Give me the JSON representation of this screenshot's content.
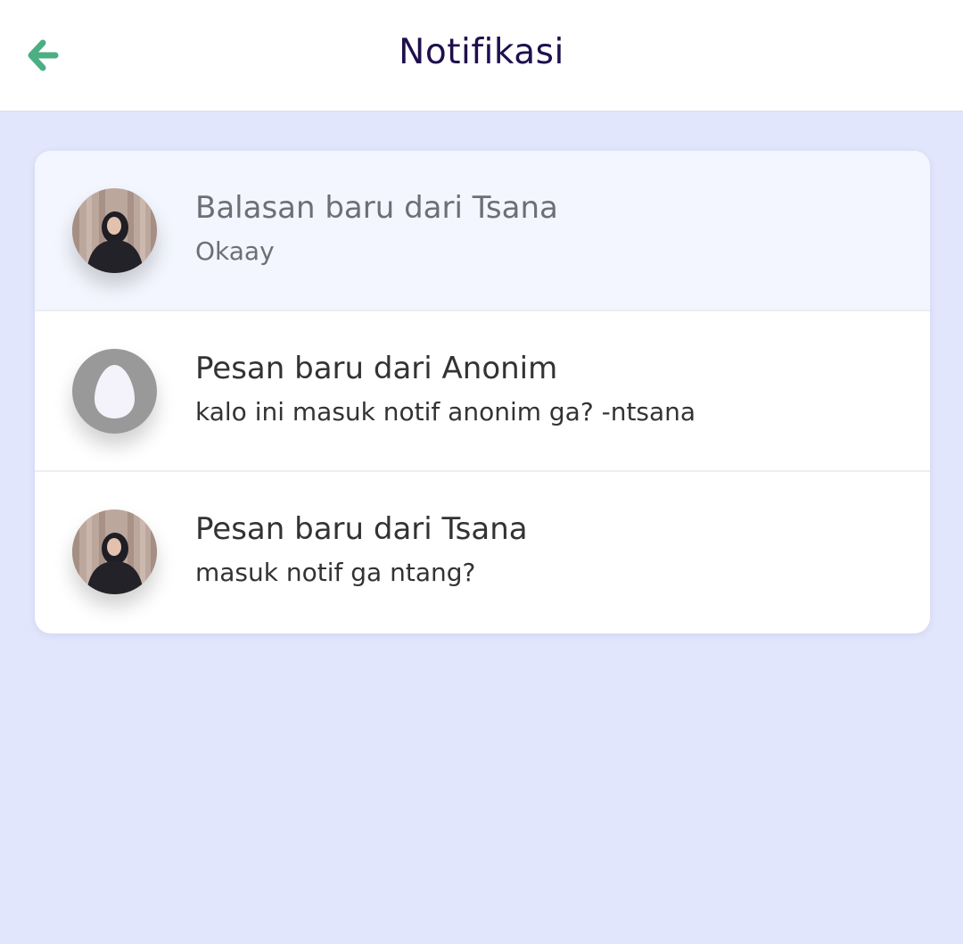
{
  "header": {
    "title": "Notifikasi",
    "back_icon": "arrow-left-icon",
    "accent_color": "#4caf83"
  },
  "notifications": [
    {
      "title": "Balasan baru dari Tsana",
      "body": "Okaay",
      "avatar": "user-photo",
      "read": true
    },
    {
      "title": "Pesan baru dari Anonim",
      "body": "kalo ini masuk notif anonim ga? -ntsana",
      "avatar": "anonymous-egg-avatar",
      "read": false
    },
    {
      "title": "Pesan baru dari Tsana",
      "body": "masuk notif ga ntang?",
      "avatar": "user-photo",
      "read": false
    }
  ],
  "colors": {
    "background": "#e1e6fc",
    "title_text": "#1f0f4d",
    "read_row_bg": "#f3f6fe"
  }
}
